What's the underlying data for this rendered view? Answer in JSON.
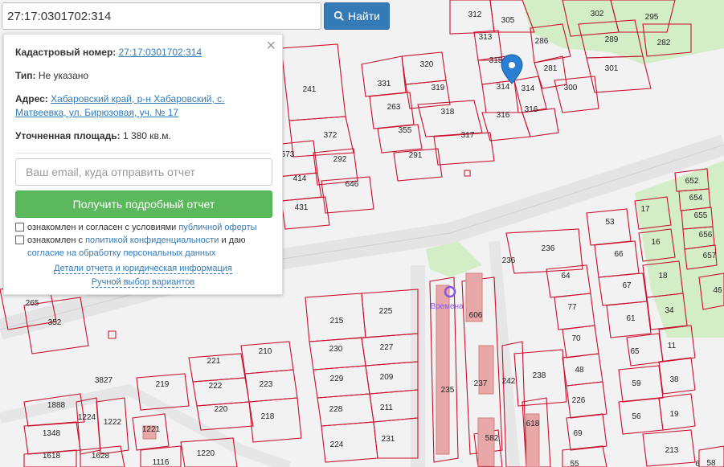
{
  "search": {
    "value": "27:17:0301702:314",
    "button_label": "Найти"
  },
  "info_panel": {
    "cadastral_label": "Кадастровый номер:",
    "cadastral_value": "27:17:0301702:314",
    "type_label": "Тип:",
    "type_value": "Не указано",
    "address_label": "Адрес:",
    "address_value": "Хабаровский край, р-н Хабаровский, с. Матвеевка, ул. Бирюзовая, уч. № 17",
    "area_label": "Уточненная площадь:",
    "area_value": "1 380 кв.м.",
    "email_placeholder": "Ваш email, куда отправить отчет",
    "report_button": "Получить подробный отчет",
    "offer_text": "ознакомлен и согласен с условиями",
    "offer_link": "публичной оферты",
    "privacy_text": "ознакомлен с",
    "privacy_link": "политикой конфиденциальности",
    "privacy_and": "и даю",
    "consent_link": "согласие на обработку персональных данных",
    "details_link": "Детали отчета и юридическая информация",
    "manual_link": "Ручной выбор вариантов"
  },
  "map": {
    "poi_label": "Времена",
    "parcels": [
      "312",
      "305",
      "302",
      "295",
      "313",
      "286",
      "289",
      "282",
      "320",
      "331",
      "319",
      "315",
      "281",
      "301",
      "263",
      "318",
      "314",
      "314",
      "300",
      "316",
      "316",
      "355",
      "317",
      "291",
      "241",
      "372",
      "573",
      "292",
      "414",
      "646",
      "431",
      "652",
      "654",
      "655",
      "656",
      "657",
      "17",
      "53",
      "16",
      "66",
      "18",
      "67",
      "34",
      "46",
      "236",
      "236",
      "64",
      "77",
      "61",
      "65",
      "11",
      "70",
      "38",
      "48",
      "59",
      "238",
      "226",
      "56",
      "19",
      "69",
      "213",
      "55",
      "58",
      "265",
      "352",
      "215",
      "225",
      "230",
      "227",
      "229",
      "209",
      "228",
      "211",
      "224",
      "231",
      "210",
      "221",
      "222",
      "223",
      "220",
      "218",
      "3827",
      "219",
      "1888",
      "1224",
      "1222",
      "1348",
      "1221",
      "1618",
      "1628",
      "1116",
      "1220",
      "606",
      "235",
      "237",
      "582",
      "618",
      "242",
      "6"
    ]
  }
}
